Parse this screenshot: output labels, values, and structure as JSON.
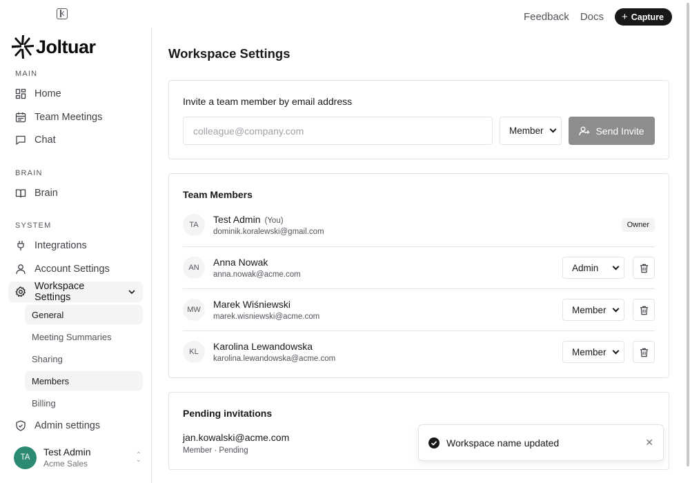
{
  "topbar": {
    "collapse_icon": "panel-left-collapse-icon",
    "links": [
      "Feedback",
      "Docs"
    ],
    "capture_label": "Capture"
  },
  "brand": {
    "name": "Joltuar",
    "accent": "#18181b"
  },
  "sidebar": {
    "sections": {
      "main": "MAIN",
      "brain": "BRAIN",
      "system": "SYSTEM"
    },
    "items": [
      {
        "label": "Home",
        "icon": "dashboard-icon"
      },
      {
        "label": "Team Meetings",
        "icon": "calendar-icon"
      },
      {
        "label": "Chat",
        "icon": "message-icon"
      },
      {
        "label": "Brain",
        "icon": "book-open-icon"
      },
      {
        "label": "Integrations",
        "icon": "plug-icon"
      },
      {
        "label": "Account Settings",
        "icon": "user-icon"
      },
      {
        "label": "Workspace Settings",
        "icon": "gear-icon",
        "active": true
      },
      {
        "label": "Admin settings",
        "icon": "shield-icon"
      }
    ],
    "sub_items": [
      {
        "label": "General",
        "active": true
      },
      {
        "label": "Meeting Summaries"
      },
      {
        "label": "Sharing"
      },
      {
        "label": "Members",
        "active": true
      },
      {
        "label": "Billing"
      }
    ],
    "user": {
      "initials": "TA",
      "name": "Test Admin",
      "org": "Acme Sales",
      "avatar_color": "#2c8a73"
    }
  },
  "page": {
    "title": "Workspace Settings"
  },
  "invite": {
    "title": "Invite a team member by email address",
    "placeholder": "colleague@company.com",
    "value": "",
    "role": "Member",
    "send_label": "Send Invite",
    "send_color": "#8d8d8d"
  },
  "members": {
    "title": "Team Members",
    "you_label": "(You)",
    "owner_label": "Owner",
    "rows": [
      {
        "initials": "TA",
        "name": "Test Admin",
        "email": "dominik.koralewski@gmail.com",
        "role": "Owner"
      },
      {
        "initials": "AN",
        "name": "Anna Nowak",
        "email": "anna.nowak@acme.com",
        "role": "Admin"
      },
      {
        "initials": "MW",
        "name": "Marek Wiśniewski",
        "email": "marek.wisniewski@acme.com",
        "role": "Member"
      },
      {
        "initials": "KL",
        "name": "Karolina Lewandowska",
        "email": "karolina.lewandowska@acme.com",
        "role": "Member"
      }
    ]
  },
  "pending": {
    "title": "Pending invitations",
    "email": "jan.kowalski@acme.com",
    "status": "Member · Pending"
  },
  "toast": {
    "message": "Workspace name updated",
    "icon": "check-circle-icon"
  }
}
